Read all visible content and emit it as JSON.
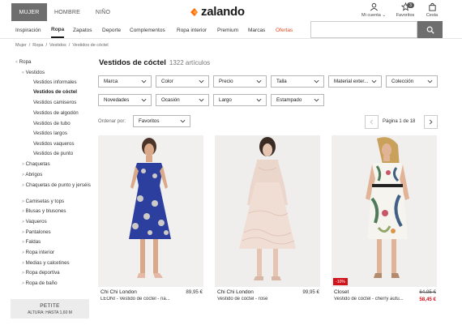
{
  "gender_tabs": [
    {
      "label": "MUJER",
      "active": true
    },
    {
      "label": "HOMBRE",
      "active": false
    },
    {
      "label": "NIÑO",
      "active": false
    }
  ],
  "logo": "zalando",
  "top_icons": {
    "account": "Mi cuenta",
    "account_chevron": "⌄",
    "favorites": "Favoritos",
    "favorites_count": "3",
    "cart": "Cesta"
  },
  "categories": [
    "Inspiración",
    "Ropa",
    "Zapatos",
    "Deporte",
    "Complementos",
    "Ropa interior",
    "Premium",
    "Marcas",
    "Ofertas"
  ],
  "breadcrumb": [
    "Mujer",
    "/",
    "Ropa",
    "/",
    "Vestidos",
    "/",
    "Vestidos de cóctel"
  ],
  "sidebar": {
    "top": "Ropa",
    "sub": "Vestidos",
    "dress_types": [
      "Vestidos informales",
      "Vestidos de cóctel",
      "Vestidos camiseros",
      "Vestidos de algodón",
      "Vestidos de tubo",
      "Vestidos largos",
      "Vestidos vaqueros",
      "Vestidos de punto"
    ],
    "categories": [
      "Chaquetas",
      "Abrigos",
      "Chaquetas de punto y jerséis",
      "Camisetas y tops",
      "Blusas y blusones",
      "Vaqueros",
      "Pantalones",
      "Faldas",
      "Ropa interior",
      "Medias y calcetines",
      "Ropa deportiva",
      "Ropa de baño"
    ],
    "petite_title": "PETITE",
    "petite_sub": "ALTURA: HASTA 1,60 M"
  },
  "main": {
    "title": "Vestidos de cóctel",
    "count": "1322 artículos",
    "filters_row1": [
      "Marca",
      "Color",
      "Precio",
      "Talla",
      "Material exter...",
      "Colección"
    ],
    "filters_row2": [
      "Novedades",
      "Ocasión",
      "Largo",
      "Estampado"
    ],
    "order_label": "Ordenar por:",
    "order_value": "Favoritos",
    "page_text": "Página 1 de 18"
  },
  "products": [
    {
      "brand": "Chi Chi London",
      "desc": "LEONI - Vestido de cóctel - na...",
      "price": "89,95 €"
    },
    {
      "brand": "Chi Chi London",
      "desc": "Vestido de cóctel - rose",
      "price": "99,95 €"
    },
    {
      "brand": "Closet",
      "desc": "Vestido de cóctel - cherry autu...",
      "old_price": "64,95 €",
      "price": "58,45 €",
      "discount": "-10%"
    }
  ],
  "colors": {
    "accent": "#ff6900",
    "nav_active": "#6e6e6e",
    "sale": "#d0121b"
  }
}
